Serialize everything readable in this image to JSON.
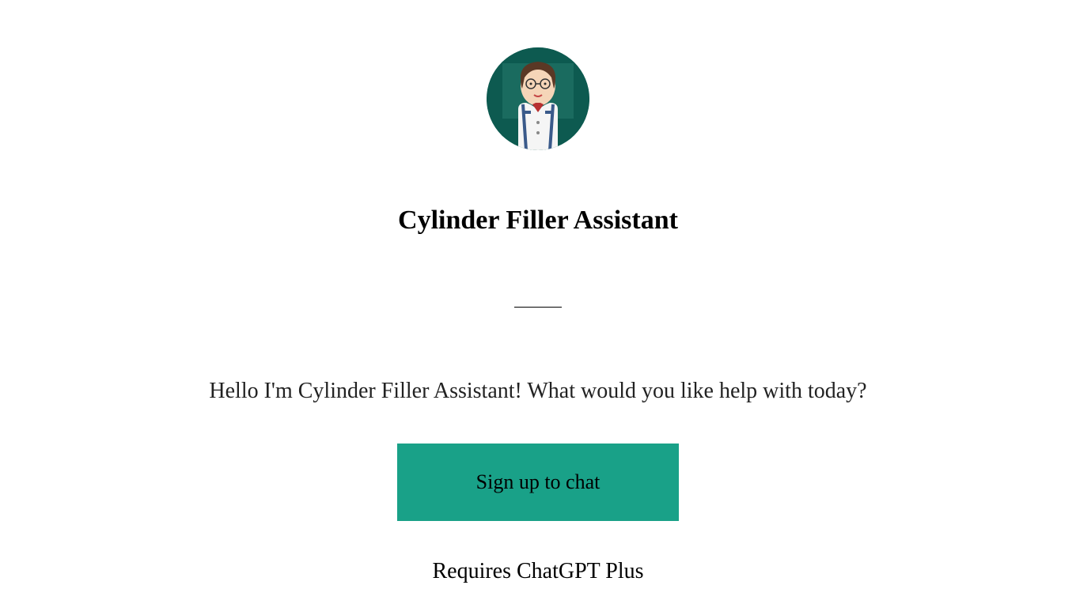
{
  "title": "Cylinder Filler Assistant",
  "greeting": "Hello I'm Cylinder Filler Assistant! What would you like help with today?",
  "signup_button_label": "Sign up to chat",
  "requires_text": "Requires ChatGPT Plus"
}
